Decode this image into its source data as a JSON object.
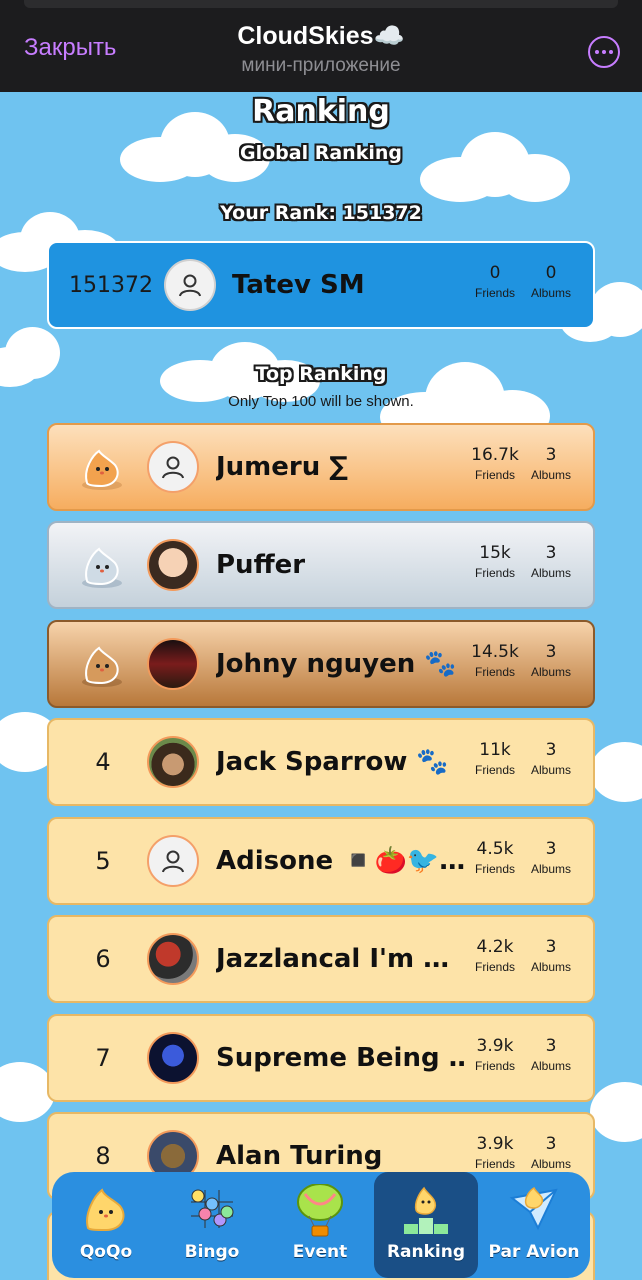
{
  "header": {
    "close_label": "Закрыть",
    "title": "CloudSkies☁️",
    "subtitle": "мини-приложение",
    "more_icon": "more-icon",
    "accent_color": "#c77dff"
  },
  "page": {
    "title": "Ranking",
    "subtitle": "Global Ranking",
    "your_rank_label": "Your Rank: 151372",
    "top_ranking_title": "Top Ranking",
    "top_ranking_note": "Only Top 100 will be shown."
  },
  "my_row": {
    "rank": "151372",
    "name": "Tatev SM",
    "friends": "0",
    "albums": "0",
    "friends_label": "Friends",
    "albums_label": "Albums"
  },
  "rows": [
    {
      "rank": "",
      "medal": "gold",
      "name": "Jumeru ∑",
      "friends": "16.7k",
      "albums": "3",
      "friends_label": "Friends",
      "albums_label": "Albums"
    },
    {
      "rank": "",
      "medal": "silver",
      "name": "Puffer",
      "friends": "15k",
      "albums": "3",
      "friends_label": "Friends",
      "albums_label": "Albums"
    },
    {
      "rank": "",
      "medal": "bronze",
      "name": "Johny nguyen 🐾",
      "friends": "14.5k",
      "albums": "3",
      "friends_label": "Friends",
      "albums_label": "Albums"
    },
    {
      "rank": "4",
      "name": "Jack Sparrow 🐾",
      "friends": "11k",
      "albums": "3",
      "friends_label": "Friends",
      "albums_label": "Albums"
    },
    {
      "rank": "5",
      "name": "Adisone ◾️🍅🐦…",
      "friends": "4.5k",
      "albums": "3",
      "friends_label": "Friends",
      "albums_label": "Albums"
    },
    {
      "rank": "6",
      "name": "Jazzlancal I'm …",
      "friends": "4.2k",
      "albums": "3",
      "friends_label": "Friends",
      "albums_label": "Albums"
    },
    {
      "rank": "7",
      "name": "Supreme Being …",
      "friends": "3.9k",
      "albums": "3",
      "friends_label": "Friends",
      "albums_label": "Albums"
    },
    {
      "rank": "8",
      "name": "Alan Turing",
      "friends": "3.9k",
      "albums": "3",
      "friends_label": "Friends",
      "albums_label": "Albums"
    }
  ],
  "nav": {
    "items": [
      {
        "label": "QoQo",
        "icon": "qoqo-icon"
      },
      {
        "label": "Bingo",
        "icon": "bingo-icon"
      },
      {
        "label": "Event",
        "icon": "balloon-icon"
      },
      {
        "label": "Ranking",
        "icon": "podium-icon",
        "active": true
      },
      {
        "label": "Par Avion",
        "icon": "paper-plane-icon"
      }
    ]
  }
}
